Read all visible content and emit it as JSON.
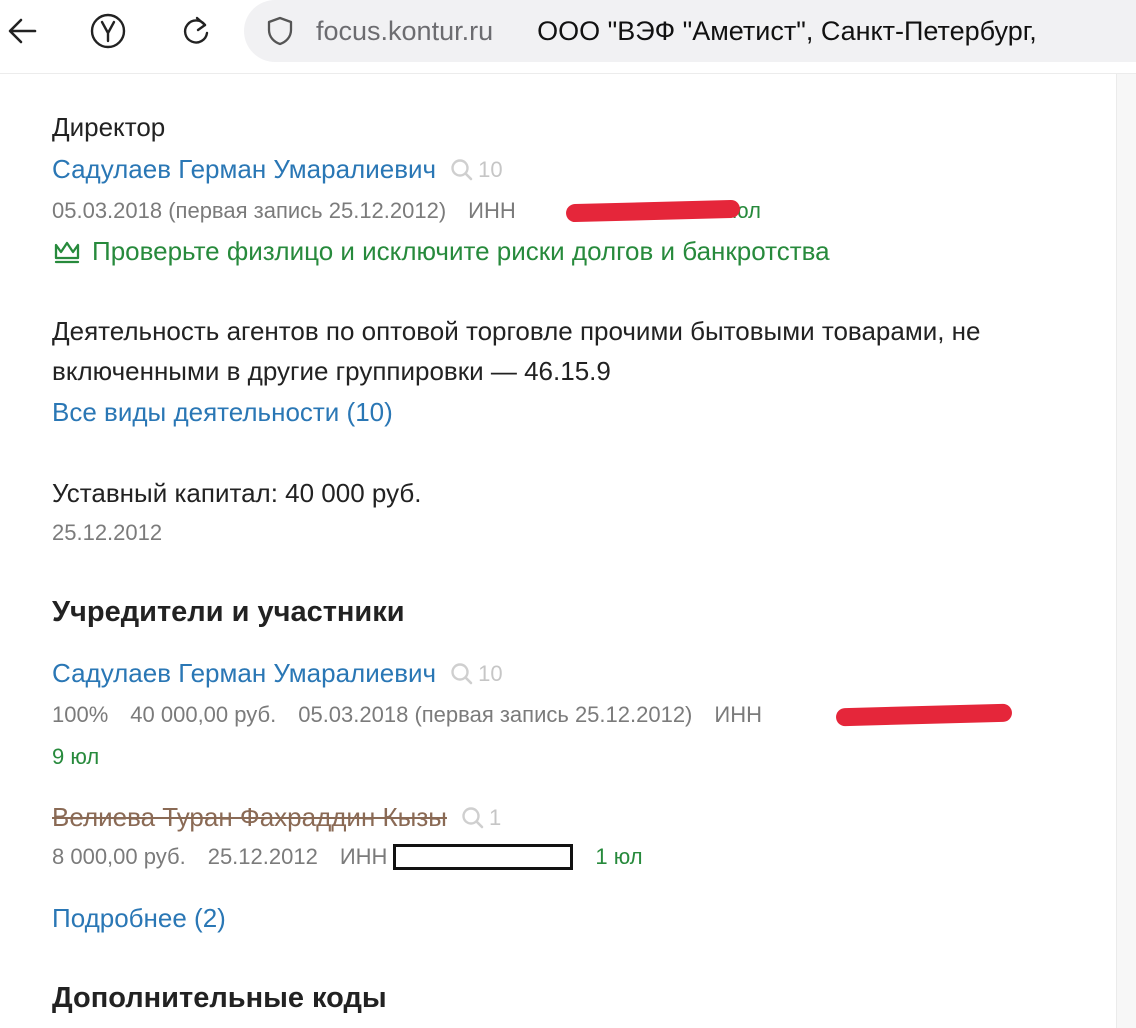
{
  "browser": {
    "domain": "focus.kontur.ru",
    "page_title": "ООО \"ВЭФ \"Аметист\", Санкт-Петербург,",
    "icons": {
      "back": "arrow-left-icon",
      "home": "yandex-logo-icon",
      "reload": "reload-icon",
      "security": "shield-icon"
    }
  },
  "director": {
    "title": "Директор",
    "name": "Садулаев Герман Умаралиевич",
    "search_count": "10",
    "date": "05.03.2018 (первая запись 25.12.2012)",
    "inn_label": "ИНН",
    "legal_count": "9 юл",
    "promo": "Проверьте физлицо и исключите риски долгов и банкротства"
  },
  "activity": {
    "main_line1": "Деятельность агентов по оптовой торговле прочими бытовыми товарами, не",
    "main_line2": "включенными в другие группировки — 46.15.9",
    "all_link": "Все виды деятельности (10)"
  },
  "capital": {
    "text": "Уставный капитал: 40 000 руб.",
    "date": "25.12.2012"
  },
  "founders": {
    "heading": "Учредители и участники",
    "items": [
      {
        "name": "Садулаев Герман Умаралиевич",
        "search_count": "10",
        "share": "100%",
        "amount": "40 000,00 руб.",
        "date": "05.03.2018 (первая запись 25.12.2012)",
        "inn_label": "ИНН",
        "legal_count": "9 юл"
      },
      {
        "name": "Велиева Туран Фахраддин Кызы",
        "search_count": "1",
        "amount": "8 000,00 руб.",
        "date": "25.12.2012",
        "inn_label": "ИНН",
        "legal_count": "1 юл"
      }
    ],
    "more_link": "Подробнее (2)"
  },
  "extra": {
    "heading": "Дополнительные коды"
  },
  "colors": {
    "link": "#2a77b5",
    "green": "#278a3c",
    "meta": "#7b7b7b",
    "redaction": "#e5263a",
    "struck": "#8a6a55"
  }
}
